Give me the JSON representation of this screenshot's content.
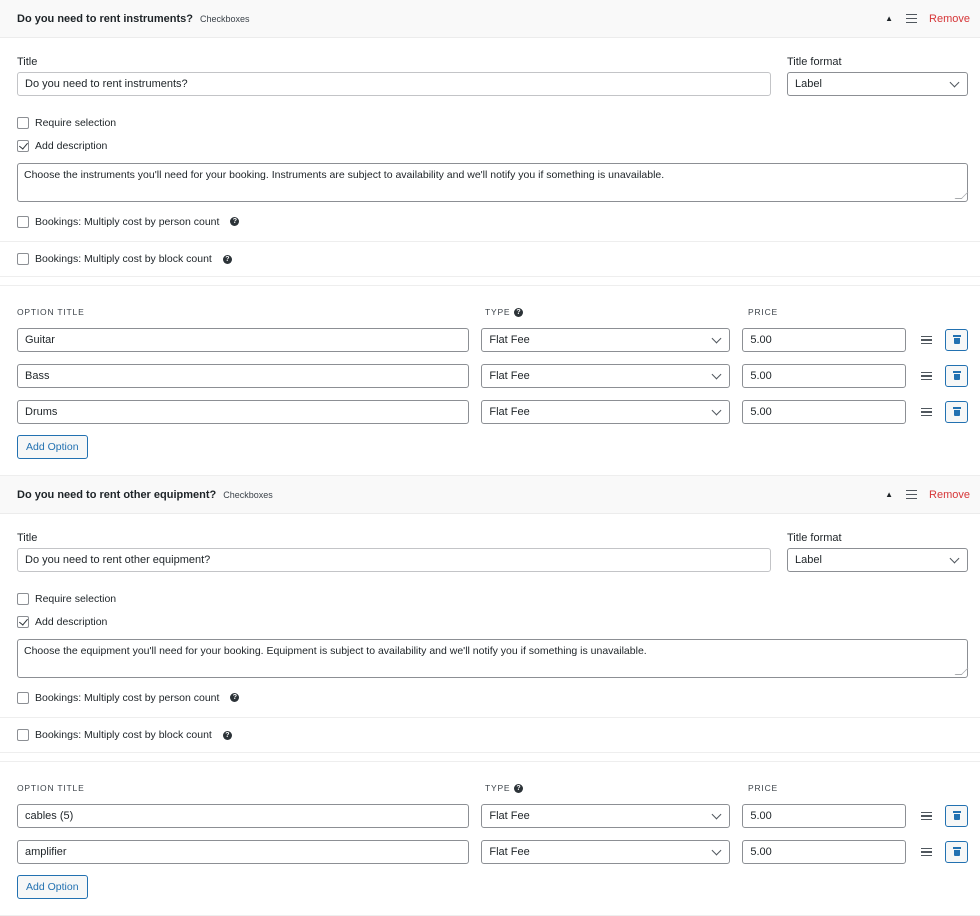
{
  "addons": [
    {
      "header_title": "Do you need to rent instruments?",
      "header_type": "Checkboxes",
      "remove_label": "Remove",
      "title_label": "Title",
      "title_value": "Do you need to rent instruments?",
      "format_label": "Title format",
      "format_value": "Label",
      "require_label": "Require selection",
      "require_checked": false,
      "desc_toggle_label": "Add description",
      "desc_checked": true,
      "description": "Choose the instruments you'll need for your booking. Instruments are subject to availability and we'll notify you if something is unavailable.",
      "multiply_person_label": "Bookings: Multiply cost by person count",
      "multiply_block_label": "Bookings: Multiply cost by block count",
      "col_option_title": "OPTION TITLE",
      "col_type": "TYPE",
      "col_price": "PRICE",
      "options": [
        {
          "title": "Guitar",
          "type": "Flat Fee",
          "price": "5.00"
        },
        {
          "title": "Bass",
          "type": "Flat Fee",
          "price": "5.00"
        },
        {
          "title": "Drums",
          "type": "Flat Fee",
          "price": "5.00"
        }
      ],
      "add_option_label": "Add Option"
    },
    {
      "header_title": "Do you need to rent other equipment?",
      "header_type": "Checkboxes",
      "remove_label": "Remove",
      "title_label": "Title",
      "title_value": "Do you need to rent other equipment?",
      "format_label": "Title format",
      "format_value": "Label",
      "require_label": "Require selection",
      "require_checked": false,
      "desc_toggle_label": "Add description",
      "desc_checked": true,
      "description": "Choose the equipment you'll need for your booking. Equipment is subject to availability and we'll notify you if something is unavailable.",
      "multiply_person_label": "Bookings: Multiply cost by person count",
      "multiply_block_label": "Bookings: Multiply cost by block count",
      "col_option_title": "OPTION TITLE",
      "col_type": "TYPE",
      "col_price": "PRICE",
      "options": [
        {
          "title": "cables (5)",
          "type": "Flat Fee",
          "price": "5.00"
        },
        {
          "title": "amplifier",
          "type": "Flat Fee",
          "price": "5.00"
        }
      ],
      "add_option_label": "Add Option"
    }
  ],
  "icons": {
    "collapse": "triangle-up-icon",
    "drag": "drag-handle-icon",
    "help": "help-icon",
    "delete": "trash-icon",
    "dropdown": "chevron-down-icon"
  },
  "colors": {
    "remove": "#d63638",
    "accent": "#2271b1",
    "header_bg": "#f9f9f9"
  }
}
